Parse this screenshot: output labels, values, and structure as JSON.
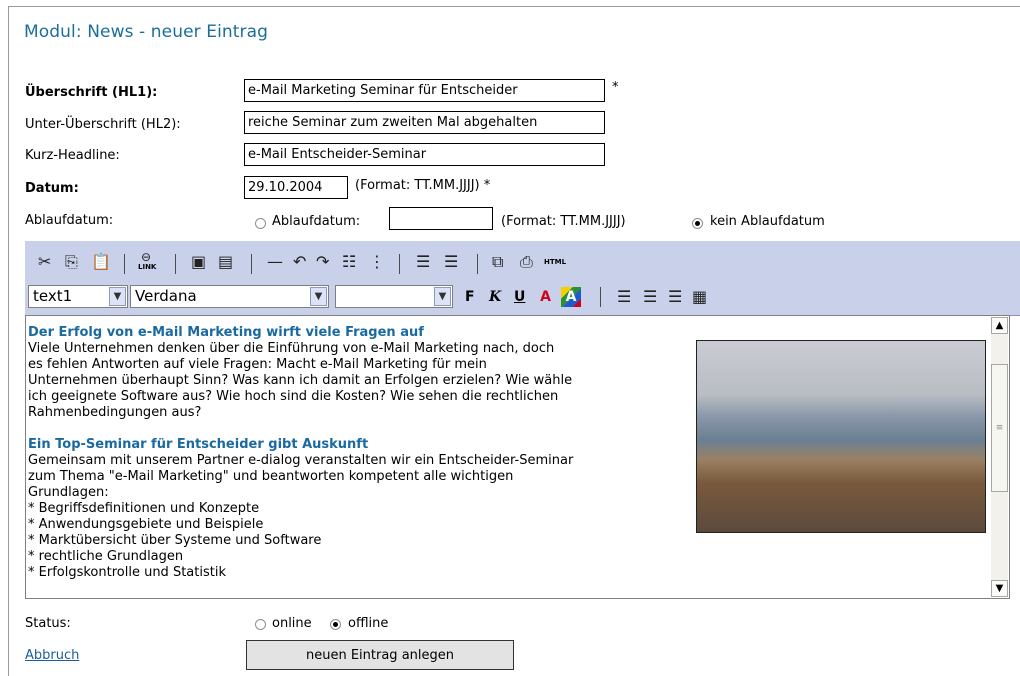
{
  "page": {
    "title": "Modul: News - neuer Eintrag"
  },
  "form": {
    "hl1_label": "Überschrift (HL1):",
    "hl1_value": "e-Mail Marketing Seminar für Entscheider",
    "hl1_required": "*",
    "hl2_label": "Unter-Überschrift (HL2):",
    "hl2_value": "reiche Seminar zum zweiten Mal abgehalten",
    "kurz_label": "Kurz-Headline:",
    "kurz_value": "e-Mail Entscheider-Seminar",
    "datum_label": "Datum:",
    "datum_value": "29.10.2004",
    "datum_hint": "(Format: TT.MM.JJJJ) *",
    "ablauf_label": "Ablaufdatum:",
    "ablauf_radio_label": "Ablaufdatum:",
    "ablauf_value": "",
    "ablauf_hint": "(Format: TT.MM.JJJJ)",
    "kein_ablauf_label": "kein Ablaufdatum",
    "ablauf_selected": "kein"
  },
  "toolbar": {
    "row1": [
      "cut-icon",
      "copy-icon",
      "paste-icon",
      "link-icon",
      "insert-image-icon",
      "image-props-icon",
      "horizontal-rule-icon",
      "undo-icon",
      "redo-icon",
      "ordered-list-icon",
      "unordered-list-icon",
      "outdent-icon",
      "indent-icon",
      "fullscreen-icon",
      "html-source-icon"
    ],
    "link_label": "LINK",
    "html_label": "HTML",
    "style_value": "text1",
    "font_value": "Verdana",
    "size_value": "",
    "bold": "F",
    "italic": "K",
    "underline": "U",
    "fontcolor": "A",
    "bgcolor": "A"
  },
  "editor": {
    "h1": "Der Erfolg von e-Mail Marketing wirft viele Fragen auf",
    "p1": [
      "Viele Unternehmen denken über die Einführung von e-Mail Marketing nach, doch",
      "es fehlen Antworten auf viele Fragen: Macht e-Mail Marketing für mein",
      "Unternehmen überhaupt Sinn? Was kann ich damit an Erfolgen erzielen? Wie wähle",
      "ich geeignete Software aus? Wie hoch sind die Kosten? Wie sehen die rechtlichen",
      "Rahmenbedingungen aus?"
    ],
    "h2": "Ein Top-Seminar für Entscheider gibt Auskunft",
    "p2": [
      "Gemeinsam mit unserem Partner e-dialog veranstalten wir ein Entscheider-Seminar",
      "zum Thema \"e-Mail Marketing\" und beantworten kompetent alle wichtigen",
      "Grundlagen:",
      "* Begriffsdefinitionen und Konzepte",
      "* Anwendungsgebiete und Beispiele",
      "* Marktübersicht über Systeme und Software",
      "* rechtliche Grundlagen",
      "* Erfolgskontrolle und Statistik"
    ]
  },
  "status": {
    "label": "Status:",
    "online_label": "online",
    "offline_label": "offline",
    "selected": "offline"
  },
  "actions": {
    "cancel_label": "Abbruch",
    "submit_label": "neuen Eintrag anlegen"
  }
}
